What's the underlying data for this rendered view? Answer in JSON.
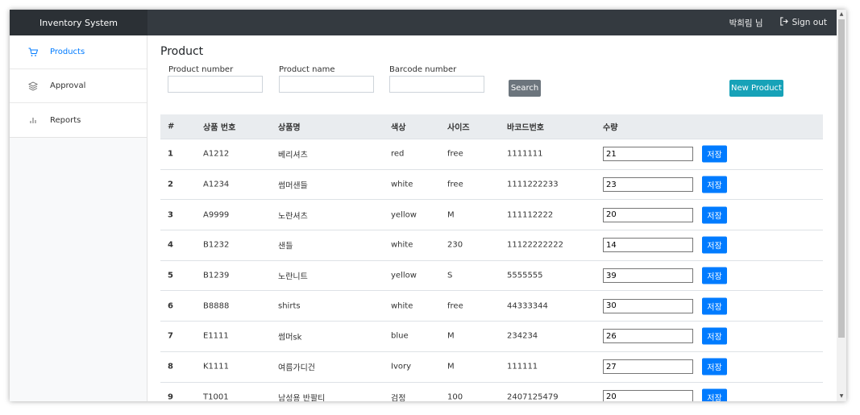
{
  "navbar": {
    "brand": "Inventory System",
    "user": "박희림 님",
    "signout": "Sign out"
  },
  "sidebar": {
    "items": [
      {
        "label": "Products",
        "icon": "cart-icon",
        "active": true
      },
      {
        "label": "Approval",
        "icon": "layers-icon",
        "active": false
      },
      {
        "label": "Reports",
        "icon": "bar-chart-icon",
        "active": false
      }
    ]
  },
  "page": {
    "title": "Product"
  },
  "filters": {
    "product_number_label": "Product number",
    "product_number_value": "",
    "product_name_label": "Product name",
    "product_name_value": "",
    "barcode_label": "Barcode number",
    "barcode_value": "",
    "search_label": "Search",
    "new_product_label": "New Product"
  },
  "table": {
    "headers": [
      "#",
      "상품 번호",
      "상품명",
      "색상",
      "사이즈",
      "바코드번호",
      "수량"
    ],
    "save_label": "저장",
    "rows": [
      {
        "idx": "1",
        "code": "A1212",
        "name": "베리셔츠",
        "color": "red",
        "size": "free",
        "barcode": "1111111",
        "qty": "21"
      },
      {
        "idx": "2",
        "code": "A1234",
        "name": "썸머샌들",
        "color": "white",
        "size": "free",
        "barcode": "1111222233",
        "qty": "23"
      },
      {
        "idx": "3",
        "code": "A9999",
        "name": "노란셔츠",
        "color": "yellow",
        "size": "M",
        "barcode": "111112222",
        "qty": "20"
      },
      {
        "idx": "4",
        "code": "B1232",
        "name": "샌들",
        "color": "white",
        "size": "230",
        "barcode": "11122222222",
        "qty": "14"
      },
      {
        "idx": "5",
        "code": "B1239",
        "name": "노란니트",
        "color": "yellow",
        "size": "S",
        "barcode": "5555555",
        "qty": "39"
      },
      {
        "idx": "6",
        "code": "B8888",
        "name": "shirts",
        "color": "white",
        "size": "free",
        "barcode": "44333344",
        "qty": "30"
      },
      {
        "idx": "7",
        "code": "E1111",
        "name": "썸머sk",
        "color": "blue",
        "size": "M",
        "barcode": "234234",
        "qty": "26"
      },
      {
        "idx": "8",
        "code": "K1111",
        "name": "여름가디건",
        "color": "Ivory",
        "size": "M",
        "barcode": "111111",
        "qty": "27"
      },
      {
        "idx": "9",
        "code": "T1001",
        "name": "남성용 반팔티",
        "color": "검정",
        "size": "100",
        "barcode": "2407125479",
        "qty": "20"
      }
    ]
  },
  "colors": {
    "navbar": "#343a40",
    "primary": "#007bff",
    "info": "#17a2b8",
    "secondary": "#6c757d"
  }
}
